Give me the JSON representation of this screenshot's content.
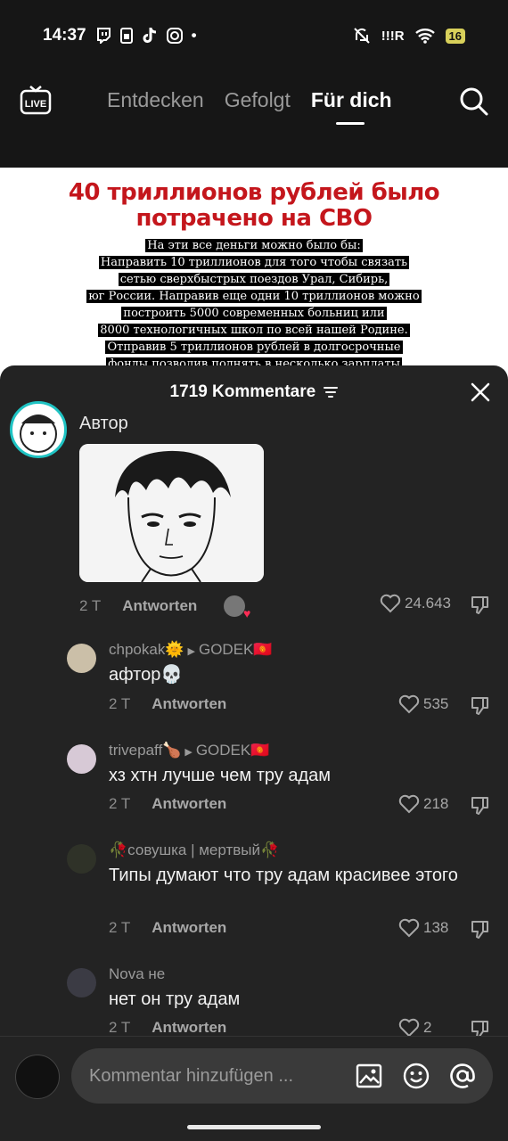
{
  "status_bar": {
    "time": "14:37",
    "app_icons": [
      "twitch-icon",
      "sim-icon",
      "tiktok-icon",
      "instagram-icon",
      "dot"
    ],
    "signal_text": "!!!R",
    "battery": "16"
  },
  "top_nav": {
    "live_label": "LIVE",
    "tabs": [
      {
        "label": "Entdecken",
        "active": false
      },
      {
        "label": "Gefolgt",
        "active": false
      },
      {
        "label": "Für dich",
        "active": true
      }
    ]
  },
  "poster": {
    "headline_line1": "40 триллионов рублей было",
    "headline_line2": "потрачено на СВО",
    "body_lines": [
      "На эти все деньги можно было бы:",
      "Направить 10 триллионов для того чтобы связать",
      "сетью сверхбыстрых поездов Урал, Сибирь,",
      "юг России. Направив еще одни 10 триллионов можно",
      "построить 5000 современных больниц или",
      "8000 технологичных школ по всей нашей Родине.",
      "Отправив  5 триллионов рублей в долгосрочные",
      "фонды позволив поднять в несколько зарплаты"
    ]
  },
  "comments_sheet": {
    "title": "1719 Kommentare",
    "main_comment": {
      "author_label": "Автор",
      "time": "2 T",
      "reply_label": "Antworten",
      "likes": "24.643"
    },
    "replies": [
      {
        "user": "chpokak🌞",
        "reply_to": "GODEK🇰🇬",
        "text": "афтор💀",
        "time": "2 T",
        "reply_label": "Antworten",
        "likes": "535"
      },
      {
        "user": "trivepaff🍗",
        "reply_to": "GODEK🇰🇬",
        "text": "хз хтн лучше чем тру адам",
        "time": "2 T",
        "reply_label": "Antworten",
        "likes": "218"
      },
      {
        "user": "🥀совушка | мертвый🥀",
        "reply_to": "",
        "text": "Типы думают что тру адам красивее этого",
        "time": "2 T",
        "reply_label": "Antworten",
        "likes": "138"
      },
      {
        "user": "Nova не",
        "reply_to": "",
        "text": "нет он тру адам",
        "time": "2 T",
        "reply_label": "Antworten",
        "likes": "2"
      }
    ]
  },
  "composer": {
    "placeholder": "Kommentar hinzufügen ..."
  }
}
